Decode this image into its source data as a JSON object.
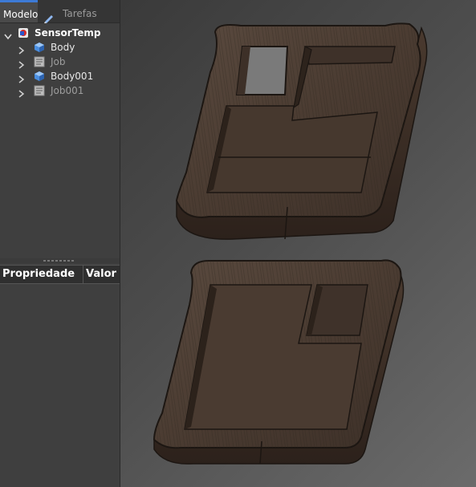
{
  "tabs": {
    "model_label": "Modelo",
    "tasks_label": "Tarefas"
  },
  "tree": {
    "root": {
      "label": "SensorTemp",
      "icon": "document-icon",
      "expanded": true
    },
    "children": [
      {
        "label": "Body",
        "icon": "body-icon",
        "greyed": false
      },
      {
        "label": "Job",
        "icon": "job-icon",
        "greyed": true
      },
      {
        "label": "Body001",
        "icon": "body-icon",
        "greyed": false
      },
      {
        "label": "Job001",
        "icon": "job-icon",
        "greyed": true
      }
    ]
  },
  "properties": {
    "col_property": "Propriedade",
    "col_value": "Valor"
  },
  "viewport": {
    "parts": [
      "part-top",
      "part-bottom"
    ],
    "material": "wood"
  },
  "colors": {
    "accent": "#3d7ad6",
    "wood_dark": "#3a2c23",
    "wood_mid": "#56453a"
  }
}
